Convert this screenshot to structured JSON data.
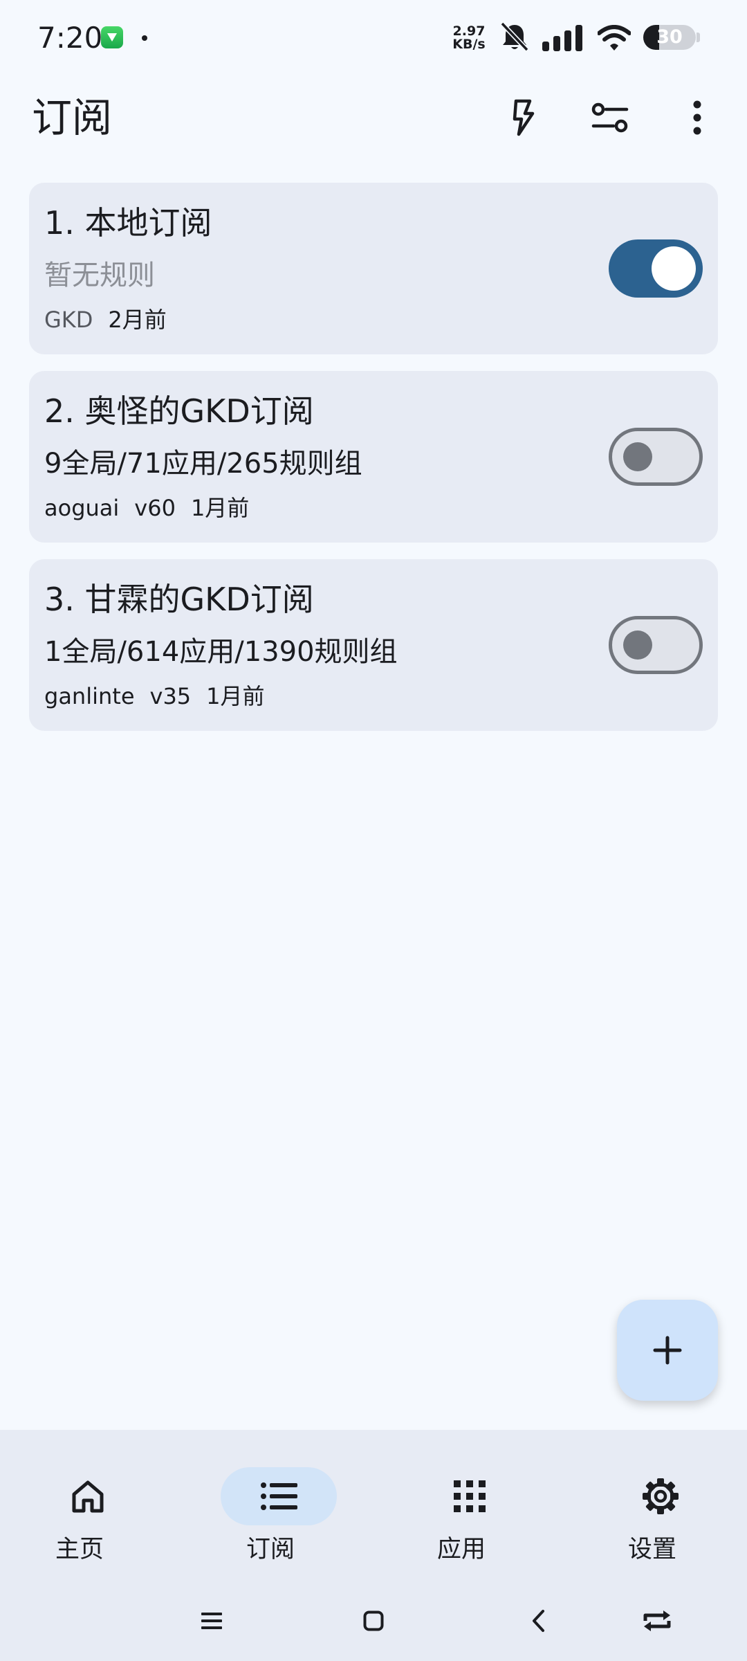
{
  "status_bar": {
    "time": "7:20",
    "net_speed_value": "2.97",
    "net_speed_unit": "KB/s",
    "battery": "30",
    "battery_level": 0.3
  },
  "header": {
    "title": "订阅"
  },
  "subscriptions": [
    {
      "title": "1. 本地订阅",
      "rules": "暂无规则",
      "author": "GKD",
      "version": "",
      "updated": "2月前",
      "enabled": true
    },
    {
      "title": "2. 奥怪的GKD订阅",
      "rules": "9全局/71应用/265规则组",
      "author": "aoguai",
      "version": "v60",
      "updated": "1月前",
      "enabled": false
    },
    {
      "title": "3. 甘霖的GKD订阅",
      "rules": "1全局/614应用/1390规则组",
      "author": "ganlinte",
      "version": "v35",
      "updated": "1月前",
      "enabled": false
    }
  ],
  "bottom_nav": {
    "items": [
      {
        "label": "主页",
        "icon": "home-icon",
        "active": false
      },
      {
        "label": "订阅",
        "icon": "list-icon",
        "active": true
      },
      {
        "label": "应用",
        "icon": "apps-grid-icon",
        "active": false
      },
      {
        "label": "设置",
        "icon": "gear-icon",
        "active": false
      }
    ]
  },
  "icons": {
    "header_actions": [
      "flash-icon",
      "tune-icon",
      "more-vertical-icon"
    ],
    "fab": "plus-icon",
    "system_nav": [
      "menu-icon",
      "home-square-icon",
      "back-icon",
      "rotate-icon"
    ]
  },
  "colors": {
    "background": "#f5f9fe",
    "card": "#e7ebf4",
    "toggle_on": "#2c6290",
    "toggle_off_outline": "#72767d",
    "nav_active_pill": "#d2e4f8",
    "fab": "#cfe3fb"
  }
}
